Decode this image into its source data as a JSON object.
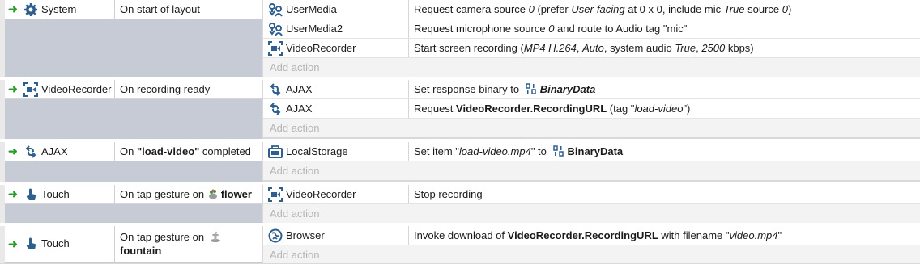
{
  "events": [
    {
      "object": "System",
      "object_icon": "gear-icon",
      "condition": "On start of layout",
      "actions": [
        {
          "object": "UserMedia",
          "icon": "usermedia-icon",
          "parts": [
            "Request camera source ",
            "0",
            " (prefer ",
            "User-facing",
            " at 0 x 0, include mic ",
            "True",
            " source ",
            "0",
            ")"
          ]
        },
        {
          "object": "UserMedia2",
          "icon": "usermedia-icon",
          "parts": [
            "Request microphone source ",
            "0",
            " and route to Audio tag \"mic\""
          ]
        },
        {
          "object": "VideoRecorder",
          "icon": "videorecorder-icon",
          "parts": [
            "Start screen recording (",
            "MP4 H.264",
            ", ",
            "Auto",
            ", system audio ",
            "True",
            ", ",
            "2500",
            " kbps)"
          ]
        }
      ],
      "add_action": "Add action"
    },
    {
      "object": "VideoRecorder",
      "object_icon": "videorecorder-icon",
      "condition": "On recording ready",
      "actions": [
        {
          "object": "AJAX",
          "icon": "ajax-icon",
          "parts": [
            "Set response binary to ",
            "BinaryData"
          ]
        },
        {
          "object": "AJAX",
          "icon": "ajax-icon",
          "parts": [
            "Request ",
            "VideoRecorder.RecordingURL",
            " (tag \"",
            "load-video",
            "\")"
          ]
        }
      ],
      "add_action": "Add action"
    },
    {
      "object": "AJAX",
      "object_icon": "ajax-icon",
      "condition_parts": [
        "On ",
        "\"load-video\"",
        " completed"
      ],
      "actions": [
        {
          "object": "LocalStorage",
          "icon": "localstorage-icon",
          "parts": [
            "Set item \"",
            "load-video.mp4",
            "\" to ",
            "BinaryData"
          ]
        }
      ],
      "add_action": "Add action"
    },
    {
      "object": "Touch",
      "object_icon": "touch-icon",
      "condition_parts": [
        "On tap gesture on ",
        "flower"
      ],
      "actions": [
        {
          "object": "VideoRecorder",
          "icon": "videorecorder-icon",
          "parts": [
            "Stop recording"
          ]
        }
      ],
      "add_action": "Add action"
    },
    {
      "object": "Touch",
      "object_icon": "touch-icon",
      "condition_parts": [
        "On tap gesture on ",
        "fountain"
      ],
      "actions": [
        {
          "object": "Browser",
          "icon": "browser-icon",
          "parts": [
            "Invoke download of ",
            "VideoRecorder.RecordingURL",
            " with filename \"",
            "video.mp4",
            "\""
          ]
        }
      ],
      "add_action": "Add action"
    }
  ],
  "colors": {
    "arrow": "#2d9a2d",
    "icon_blue": "#2f5f8f",
    "condition_bg": "#c7cbd5",
    "add_action_text": "#b5b5b5"
  }
}
